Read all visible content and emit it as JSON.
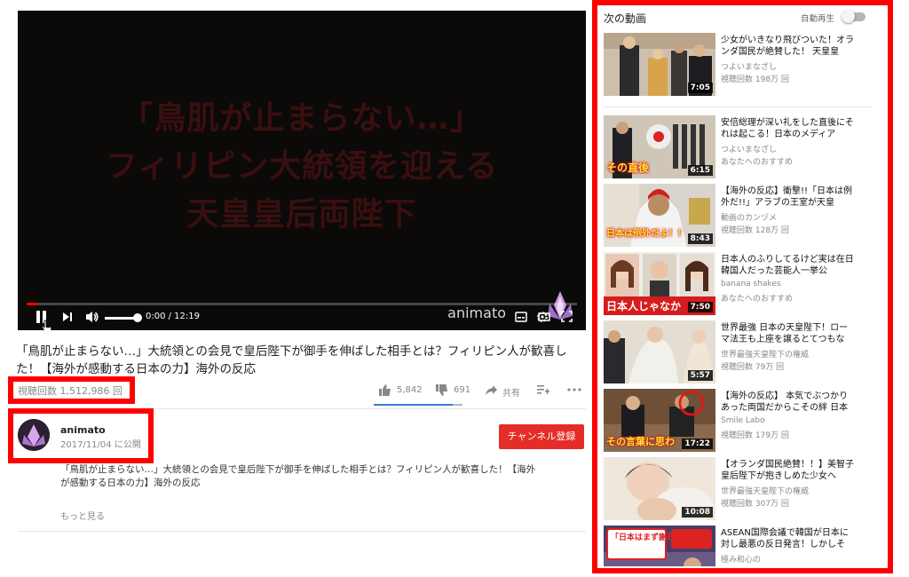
{
  "player": {
    "overlay_line1": "「鳥肌が止まらない…」",
    "overlay_line2": "フィリピン大統領を迎える",
    "overlay_line3": "天皇皇后両陛下",
    "watermark": "animato",
    "time": "0:00 / 12:19",
    "progress": 0.02,
    "icons": [
      "pause-icon",
      "next-icon",
      "volume-icon",
      "subtitles-icon",
      "settings-icon",
      "theater-icon",
      "fullscreen-icon"
    ]
  },
  "video": {
    "title": "「鳥肌が止まらない…」大統領との会見で皇后陛下が御手を伸ばした相手とは？フィリピン人が歓喜した！【海外が感動する日本の力】海外の反応",
    "views": "視聴回数 1,512,986 回",
    "likes": "5,842",
    "dislikes": "691",
    "share": "共有",
    "like_ratio": 0.894
  },
  "channel": {
    "name": "animato",
    "date": "2017/11/04 に公開",
    "subscribe": "チャンネル登録",
    "description": "「鳥肌が止まらない…」大統領との会見で皇后陛下が御手を伸ばした相手とは？フィリピン人が歓喜した！【海外が感動する日本の力】海外の反応",
    "show_more": "もっと見る"
  },
  "sidebar": {
    "header": "次の動画",
    "autoplay": "自動再生",
    "videos": [
      {
        "title": "少女がいきなり飛びついた！オランダ国民が絶賛した！ 天皇皇",
        "channel": "つよいまなざし",
        "views": "視聴回数 198万 回",
        "duration": "7:05",
        "caption": ""
      },
      {
        "title": "安倍総理が深い礼をした直後にそれは起こる！日本のメディア",
        "channel": "つよいまなざし",
        "views": "あなたへのおすすめ",
        "duration": "6:15",
        "caption": "その直後"
      },
      {
        "title": "【海外の反応】衝撃!!「日本は例外だ!!」アラブの王室が天皇",
        "channel": "動画のカンヅメ",
        "views": "視聴回数 128万 回",
        "duration": "8:43",
        "caption": "日本は例外だよ！！"
      },
      {
        "title": "日本人のふりしてるけど実は在日韓国人だった芸能人一挙公",
        "channel": "banana shakes",
        "views": "あなたへのおすすめ",
        "duration": "7:50",
        "caption": "日本人じゃなか"
      },
      {
        "title": "世界最強 日本の天皇陛下！ローマ法王も上座を譲るとてつもな",
        "channel": "世界最強天皇陛下の権威",
        "views": "視聴回数 79万 回",
        "duration": "5:57",
        "caption": ""
      },
      {
        "title": "【海外の反応】 本気でぶつかりあった両国だからこその絆 日本",
        "channel": "Smile Labo",
        "views": "視聴回数 179万 回",
        "duration": "17:22",
        "caption": "その言葉に思わ"
      },
      {
        "title": "【オランダ国民絶賛！！】美智子皇后陛下が抱きしめた少女へ",
        "channel": "世界最強天皇陛下の権威",
        "views": "視聴回数 307万 回",
        "duration": "10:08",
        "caption": ""
      },
      {
        "title": "ASEAN国際会議で韓国が日本に対し最悪の反日発言！しかしそ",
        "channel": "極み和心の",
        "views": "",
        "duration": "",
        "caption": "「日本はまず謝罪を…」"
      }
    ]
  }
}
